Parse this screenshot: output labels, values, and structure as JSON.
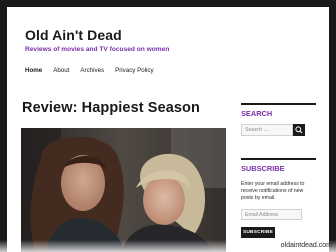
{
  "site": {
    "title": "Old Ain't Dead",
    "description": "Reviews of movies and TV focused on women"
  },
  "nav": {
    "items": [
      {
        "label": "Home",
        "active": true
      },
      {
        "label": "About",
        "active": false
      },
      {
        "label": "Archives",
        "active": false
      },
      {
        "label": "Privacy Policy",
        "active": false
      }
    ]
  },
  "post": {
    "title": "Review: Happiest Season"
  },
  "sidebar": {
    "search": {
      "title": "SEARCH",
      "placeholder": "Search …",
      "button_icon": "search-icon"
    },
    "subscribe": {
      "title": "SUBSCRIBE",
      "text": "Enter your email address to receive notifications of new posts by email.",
      "email_placeholder": "Email Address",
      "button_label": "SUBSCRIBE"
    }
  },
  "footer": {
    "domain": "oldaintdead.com"
  },
  "colors": {
    "accent": "#7b2fa6",
    "frame": "#1a1a1a",
    "button": "#1a1a1a"
  }
}
